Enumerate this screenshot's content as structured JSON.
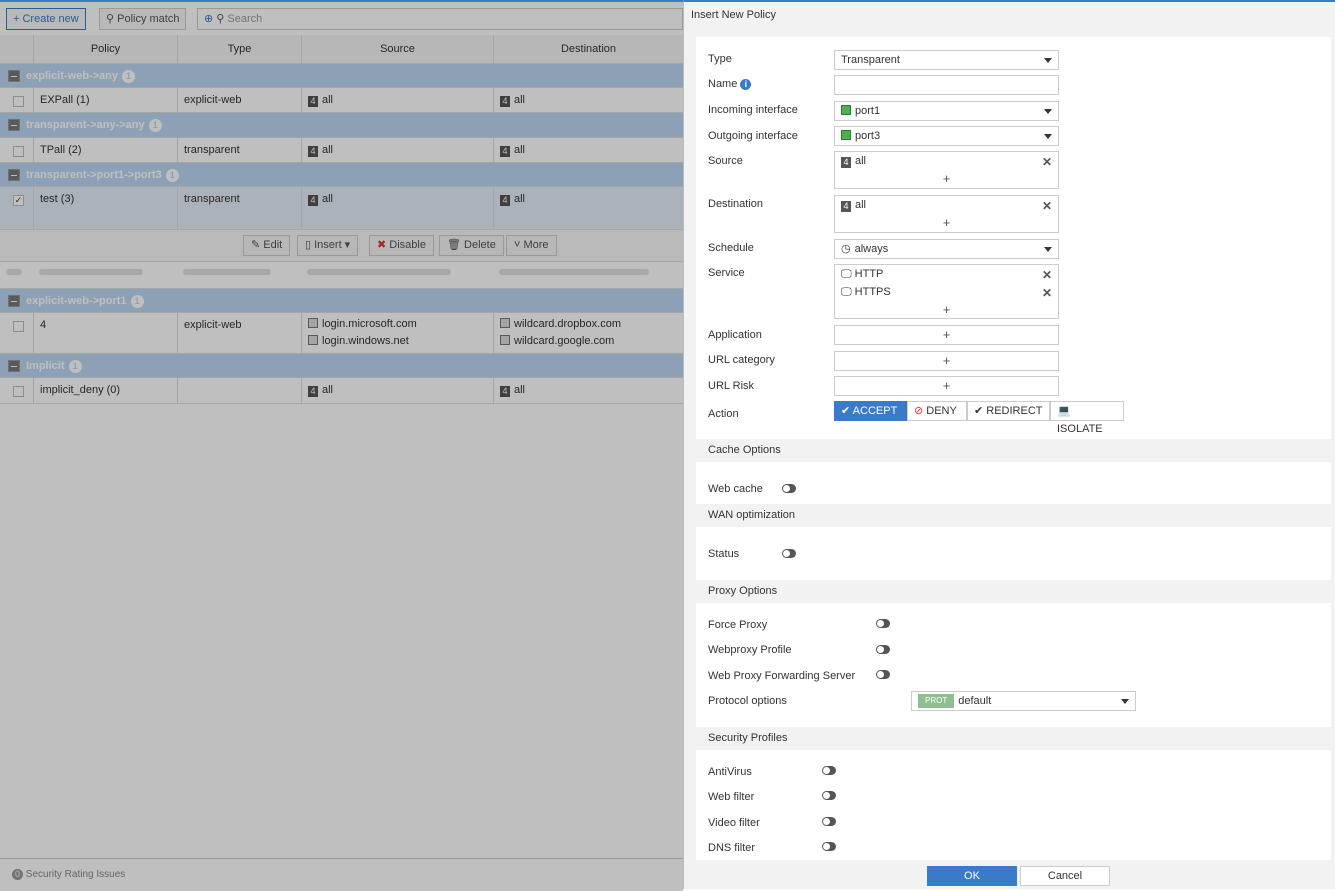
{
  "toolbar": {
    "create_new": "Create new",
    "policy_match": "Policy match",
    "search_placeholder": "Search"
  },
  "table": {
    "headers": [
      "Policy",
      "Type",
      "Source",
      "Destination"
    ],
    "groups": [
      {
        "name": "explicit-web->any",
        "count": "1",
        "rows": [
          {
            "policy": "EXPall (1)",
            "type": "explicit-web",
            "source": [
              "all"
            ],
            "destination": [
              "all"
            ]
          }
        ]
      },
      {
        "name": "transparent->any->any",
        "count": "1",
        "rows": [
          {
            "policy": "TPall (2)",
            "type": "transparent",
            "source": [
              "all"
            ],
            "destination": [
              "all"
            ]
          }
        ]
      },
      {
        "name": "transparent->port1->port3",
        "count": "1",
        "rows": [
          {
            "policy": "test (3)",
            "type": "transparent",
            "source": [
              "all"
            ],
            "destination": [
              "all"
            ]
          }
        ]
      },
      {
        "name": "explicit-web->port1",
        "count": "1",
        "rows": [
          {
            "policy": "4",
            "type": "explicit-web",
            "source": [
              "login.microsoft.com",
              "login.windows.net"
            ],
            "destination": [
              "wildcard.dropbox.com",
              "wildcard.google.com"
            ]
          }
        ]
      },
      {
        "name": "Implicit",
        "count": "1",
        "rows": [
          {
            "policy": "implicit_deny (0)",
            "type": "",
            "source": [
              "all"
            ],
            "destination": [
              "all"
            ]
          }
        ]
      }
    ]
  },
  "row_actions": {
    "edit": "Edit",
    "insert": "Insert",
    "disable": "Disable",
    "delete": "Delete",
    "more": "More"
  },
  "status_bar": {
    "count": "0",
    "label": "Security Rating Issues"
  },
  "panel": {
    "title": "Insert New Policy",
    "labels": {
      "type": "Type",
      "name": "Name",
      "incoming": "Incoming interface",
      "outgoing": "Outgoing interface",
      "source": "Source",
      "destination": "Destination",
      "schedule": "Schedule",
      "service": "Service",
      "application": "Application",
      "url_category": "URL category",
      "url_risk": "URL Risk",
      "action": "Action"
    },
    "values": {
      "type": "Transparent",
      "name": "",
      "incoming": "port1",
      "outgoing": "port3",
      "source": "all",
      "destination": "all",
      "schedule": "always",
      "services": [
        "HTTP",
        "HTTPS"
      ]
    },
    "actions": {
      "accept": "ACCEPT",
      "deny": "DENY",
      "redirect": "REDIRECT",
      "isolate": "ISOLATE",
      "selected": "ACCEPT"
    },
    "sections": {
      "cache": "Cache Options",
      "wan": "WAN optimization",
      "proxy": "Proxy Options",
      "security": "Security Profiles"
    },
    "toggles": {
      "web_cache": "Web cache",
      "status": "Status",
      "force_proxy": "Force Proxy",
      "webproxy_profile": "Webproxy Profile",
      "forwarding_server": "Web Proxy Forwarding Server",
      "antivirus": "AntiVirus",
      "web_filter": "Web filter",
      "video_filter": "Video filter",
      "dns_filter": "DNS filter"
    },
    "protocol_options": {
      "label": "Protocol options",
      "badge": "PROT",
      "value": "default"
    },
    "ok": "OK",
    "cancel": "Cancel"
  },
  "colors": {
    "accent": "#3a7bc8",
    "group_row": "#bcd7f3"
  }
}
